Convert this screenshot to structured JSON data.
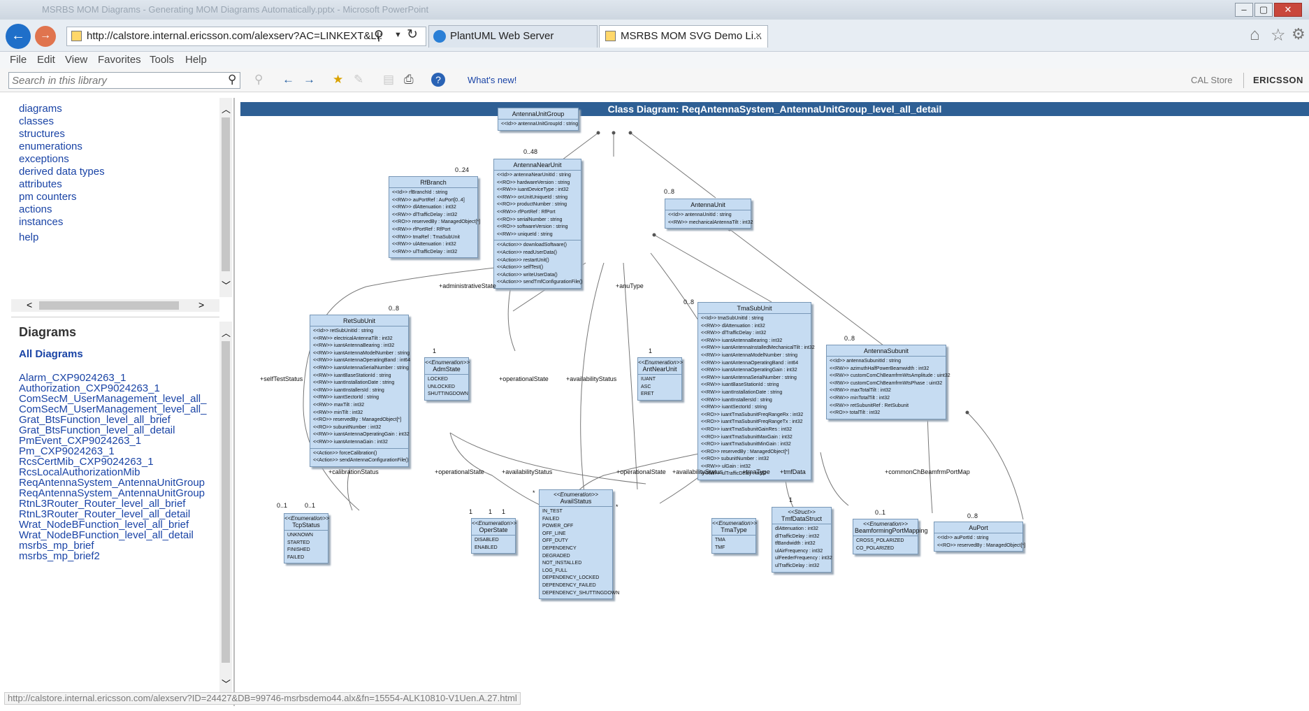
{
  "browser": {
    "window_title": "MSRBS MOM Diagrams - Generating MOM Diagrams Automatically.pptx - Microsoft PowerPoint",
    "address": "http://calstore.internal.ericsson.com/alexserv?AC=LINKEXT&LI:",
    "tabs": [
      {
        "label": "PlantUML Web Server"
      },
      {
        "label": "MSRBS MOM SVG Demo Li..."
      }
    ],
    "tab_close": "×",
    "menu": [
      "File",
      "Edit",
      "View",
      "Favorites",
      "Tools",
      "Help"
    ],
    "status_url": "http://calstore.internal.ericsson.com/alexserv?ID=24427&DB=99746-msrbsdemo44.alx&fn=15554-ALK10810-V1Uen.A.27.html"
  },
  "toolbar": {
    "search_placeholder": "Search in this library",
    "whats_new": "What's new!",
    "cal_store": "CAL Store",
    "brand": "ERICSSON"
  },
  "sidebar": {
    "top_links": [
      "diagrams",
      "classes",
      "structures",
      "enumerations",
      "exceptions",
      "derived data types",
      "attributes",
      "pm counters",
      "actions",
      "instances"
    ],
    "help": "help",
    "diagrams_heading": "Diagrams",
    "all_diagrams": "All Diagrams",
    "diagram_links": [
      "Alarm_CXP9024263_1",
      "Authorization_CXP9024263_1",
      "ComSecM_UserManagement_level_all_",
      "ComSecM_UserManagement_level_all_",
      "Grat_BtsFunction_level_all_brief",
      "Grat_BtsFunction_level_all_detail",
      "PmEvent_CXP9024263_1",
      "Pm_CXP9024263_1",
      "RcsCertMib_CXP9024263_1",
      "RcsLocalAuthorizationMib",
      "ReqAntennaSystem_AntennaUnitGroup",
      "ReqAntennaSystem_AntennaUnitGroup",
      "RtnL3Router_Router_level_all_brief",
      "RtnL3Router_Router_level_all_detail",
      "Wrat_NodeBFunction_level_all_brief",
      "Wrat_NodeBFunction_level_all_detail",
      "msrbs_mp_brief",
      "msrbs_mp_brief2"
    ]
  },
  "diagram": {
    "title": "Class Diagram:  ReqAntennaSystem_AntennaUnitGroup_level_all_detail",
    "classes": {
      "aug": {
        "name": "AntennaUnitGroup",
        "attrs": [
          "<<Id>> antennaUnitGroupId : string"
        ]
      },
      "rfb": {
        "name": "RfBranch",
        "attrs": [
          "<<Id>> rfBranchId : string",
          "<<RW>> auPortRef : AuPort[0..4]",
          "<<RW>> dlAttenuation : int32",
          "<<RW>> dlTrafficDelay : int32",
          "<<RO>> reservedBy : ManagedObject[*]",
          "<<RW>> rfPortRef : RfPort",
          "<<RW>> tmaRef : TmaSubUnit",
          "<<RW>> ulAttenuation : int32",
          "<<RW>> ulTrafficDelay : int32"
        ]
      },
      "anu": {
        "name": "AntennaNearUnit",
        "attrs": [
          "<<Id>> antennaNearUnitId : string",
          "<<RO>> hardwareVersion : string",
          "<<RW>> iuantDeviceType : int32",
          "<<RW>> onUnitUniqueId : string",
          "<<RO>> productNumber : string",
          "<<RW>> rfPortRef : RfPort",
          "<<RO>> serialNumber : string",
          "<<RO>> softwareVersion : string",
          "<<RW>> uniqueId : string"
        ],
        "actions": [
          "<<Action>> downloadSoftware()",
          "<<Action>> readUserData()",
          "<<Action>> restartUnit()",
          "<<Action>> selfTest()",
          "<<Action>> writeUserData()",
          "<<Action>> sendTmfConfigurationFile()"
        ]
      },
      "au": {
        "name": "AntennaUnit",
        "attrs": [
          "<<Id>> antennaUnitId : string",
          "<<RW>> mechanicalAntennaTilt : int32"
        ]
      },
      "ret": {
        "name": "RetSubUnit",
        "attrs": [
          "<<Id>> retSubUnitId : string",
          "<<RW>> electricalAntennaTilt : int32",
          "<<RW>> iuantAntennaBearing : int32",
          "<<RW>> iuantAntennaModelNumber : string",
          "<<RW>> iuantAntennaOperatingBand : int64",
          "<<RW>> iuantAntennaSerialNumber : string",
          "<<RW>> iuantBaseStationId : string",
          "<<RW>> iuantInstallationDate : string",
          "<<RW>> iuantInstallersId : string",
          "<<RW>> iuantSectorId : string",
          "<<RW>> maxTilt : int32",
          "<<RW>> minTilt : int32",
          "<<RO>> reservedBy : ManagedObject[*]",
          "<<RO>> subunitNumber : int32",
          "<<RW>> iuantAntennaOperatingGain : int32",
          "<<RW>> iuantAntennaGain : int32"
        ],
        "actions": [
          "<<Action>> forceCalibration()",
          "<<Action>> sendAntennaConfigurationFile()"
        ]
      },
      "adm": {
        "stereo": "<<Enumeration>>",
        "name": "AdmState",
        "attrs": [
          "LOCKED",
          "UNLOCKED",
          "SHUTTINGDOWN"
        ]
      },
      "anut": {
        "stereo": "<<Enumeration>>",
        "name": "AntNearUnit",
        "attrs": [
          "IUANT",
          "ASC",
          "ERET"
        ]
      },
      "tma": {
        "name": "TmaSubUnit",
        "attrs": [
          "<<Id>> tmaSubUnitId : string",
          "<<RW>> dlAttenuation : int32",
          "<<RW>> dlTrafficDelay : int32",
          "<<RW>> iuantAntennaBearing : int32",
          "<<RW>> iuantAntennaInstalledMechanicalTilt : int32",
          "<<RW>> iuantAntennaModelNumber : string",
          "<<RW>> iuantAntennaOperatingBand : int64",
          "<<RW>> iuantAntennaOperatingGain : int32",
          "<<RW>> iuantAntennaSerialNumber : string",
          "<<RW>> iuantBaseStationId : string",
          "<<RW>> iuantInstallationDate : string",
          "<<RW>> iuantInstallersId : string",
          "<<RW>> iuantSectorId : string",
          "<<RO>> iuantTmaSubunitFreqRangeRx : int32",
          "<<RO>> iuantTmaSubunitFreqRangeTx : int32",
          "<<RO>> iuantTmaSubunitGainRes : int32",
          "<<RO>> iuantTmaSubunitMaxGain : int32",
          "<<RO>> iuantTmaSubunitMinGain : int32",
          "<<RO>> reservedBy : ManagedObject[*]",
          "<<RO>> subunitNumber : int32",
          "<<RW>> ulGain : int32",
          "<<RW>> ulTrafficDelay : int32"
        ]
      },
      "asu": {
        "name": "AntennaSubunit",
        "attrs": [
          "<<Id>> antennaSubunitId : string",
          "<<RW>> azimuthHalfPowerBeamwidth : int32",
          "<<RW>> customComChBeamfrmWtsAmplitude : uint32",
          "<<RW>> customComChBeamfrmWtsPhase : uint32",
          "<<RW>> maxTotalTilt : int32",
          "<<RW>> minTotalTilt : int32",
          "<<RW>> retSubunitRef : RetSubunit",
          "<<RO>> totalTilt : int32"
        ]
      },
      "tcp": {
        "stereo": "<<Enumeration>>",
        "name": "TcpStatus",
        "attrs": [
          "UNKNOWN",
          "STARTED",
          "FINISHED",
          "FAILED"
        ]
      },
      "ops": {
        "stereo": "<<Enumeration>>",
        "name": "OperState",
        "attrs": [
          "DISABLED",
          "ENABLED"
        ]
      },
      "avs": {
        "stereo": "<<Enumeration>>",
        "name": "AvailStatus",
        "attrs": [
          "IN_TEST",
          "FAILED",
          "POWER_OFF",
          "OFF_LINE",
          "OFF_DUTY",
          "DEPENDENCY",
          "DEGRADED",
          "NOT_INSTALLED",
          "LOG_FULL",
          "DEPENDENCY_LOCKED",
          "DEPENDENCY_FAILED",
          "DEPENDENCY_SHUTTINGDOWN"
        ]
      },
      "tmt": {
        "stereo": "<<Enumeration>>",
        "name": "TmaType",
        "attrs": [
          "TMA",
          "TMF"
        ]
      },
      "tmf": {
        "stereo": "<<Struct>>",
        "name": "TmfDataStruct",
        "attrs": [
          "dlAttenuation : int32",
          "dlTrafficDelay : int32",
          "tfBandwidth : int32",
          "ulAirFrequency : int32",
          "ulFeederFrequency : int32",
          "ulTrafficDelay : int32"
        ]
      },
      "bfp": {
        "stereo": "<<Enumeration>>",
        "name": "BeamformingPortMapping",
        "attrs": [
          "CROSS_POLARIZED",
          "CO_POLARIZED"
        ]
      },
      "aup": {
        "name": "AuPort",
        "attrs": [
          "<<Id>> auPortId : string",
          "<<RO>> reservedBy : ManagedObject[*]"
        ]
      }
    },
    "labels": {
      "m_024": "0..24",
      "m_048": "0..48",
      "m_08_au": "0..8",
      "m_08_ret": "0..8",
      "m_08_tma": "0..8",
      "m_08_asu": "0..8",
      "m_08_aup": "0..8",
      "administrativeState": "+administrativeState",
      "anuType": "+anuType",
      "selfTestStatus": "+selfTestStatus",
      "operationalState1": "+operationalState",
      "availabilityStatus1": "+availabilityStatus",
      "calibrationStatus": "+calibrationStatus",
      "operationalState2": "+operationalState",
      "availabilityStatus2": "+availabilityStatus",
      "operationalState3": "+operationalState",
      "availabilityStatus3": "+availabilityStatus",
      "tmaType": "+tmaType",
      "tmfData": "+tmfData",
      "commonChBeamfrmPortMap": "+commonChBeamfrmPortMap",
      "one_a": "1",
      "one_b": "1",
      "one_c": "1",
      "one_d": "1",
      "one_e": "1",
      "one_f": "1",
      "m01_a": "0..1",
      "m01_b": "0..1",
      "m01_c": "0..1",
      "star_a": "*",
      "star_b": "*"
    }
  }
}
